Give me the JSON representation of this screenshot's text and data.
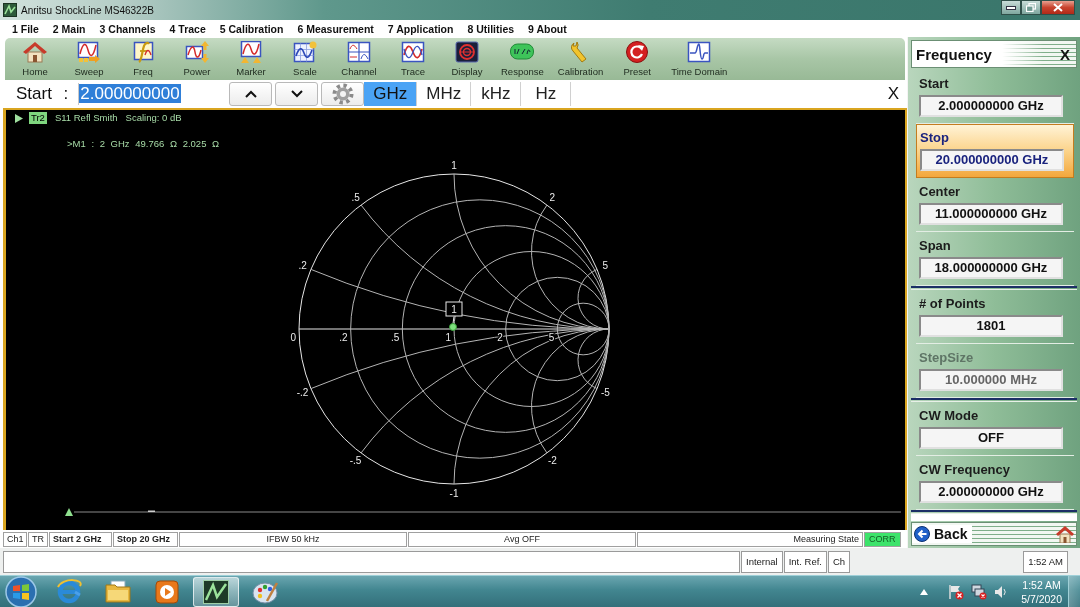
{
  "window": {
    "title": "Anritsu ShockLine MS46322B"
  },
  "menu": [
    "1 File",
    "2 Main",
    "3 Channels",
    "4 Trace",
    "5 Calibration",
    "6 Measurement",
    "7 Application",
    "8 Utilities",
    "9 About"
  ],
  "toolbar": [
    "Home",
    "Sweep",
    "Freq",
    "Power",
    "Marker",
    "Scale",
    "Channel",
    "Trace",
    "Display",
    "Response",
    "Calibration",
    "Preset",
    "Time Domain"
  ],
  "entry": {
    "label": "Start :",
    "value": "2.000000000",
    "value_selected": true,
    "units": [
      {
        "label": "GHz",
        "selected": true
      },
      {
        "label": "MHz",
        "selected": false
      },
      {
        "label": "kHz",
        "selected": false
      },
      {
        "label": "Hz",
        "selected": false
      }
    ],
    "close": "X"
  },
  "trace": {
    "badge": "Tr2",
    "title": "S11 Refl Smith",
    "scaling": "Scaling: 0 dB",
    "marker_readout": ">M1 : 2 GHz 49.766 Ω 2.025 Ω"
  },
  "smith_chart": {
    "resistance_labels": [
      "0",
      ".2",
      ".5",
      "1",
      "2",
      "5"
    ],
    "upper_reactance_labels": [
      ".2",
      ".5",
      "1",
      "2",
      "5"
    ],
    "lower_reactance_labels": [
      "-.2",
      "-.5",
      "-1",
      "-2",
      "-5"
    ],
    "marker_label": "1"
  },
  "side_panel": {
    "title": "Frequency",
    "close": "X",
    "groups": [
      {
        "items": [
          {
            "label": "Start",
            "value": "2.000000000 GHz",
            "selected": false,
            "disabled": false
          },
          {
            "label": "Stop",
            "value": "20.000000000 GHz",
            "selected": true,
            "disabled": false
          },
          {
            "label": "Center",
            "value": "11.000000000 GHz",
            "selected": false,
            "disabled": false
          },
          {
            "label": "Span",
            "value": "18.000000000 GHz",
            "selected": false,
            "disabled": false
          }
        ]
      },
      {
        "items": [
          {
            "label": "# of Points",
            "value": "1801",
            "selected": false,
            "disabled": false
          },
          {
            "label": "StepSize",
            "value": "10.000000 MHz",
            "selected": false,
            "disabled": true
          }
        ]
      },
      {
        "items": [
          {
            "label": "CW Mode",
            "value": "OFF",
            "selected": false,
            "disabled": false
          },
          {
            "label": "CW Frequency",
            "value": "2.000000000 GHz",
            "selected": false,
            "disabled": false
          }
        ]
      }
    ],
    "back": "Back"
  },
  "status_bar": {
    "cells": [
      {
        "text": "Ch1",
        "bold": false
      },
      {
        "text": "TR",
        "bold": false
      },
      {
        "text": "Start 2 GHz",
        "bold": true
      },
      {
        "text": "Stop 20 GHz",
        "bold": true
      },
      {
        "text": "IFBW 50 kHz",
        "bold": false
      },
      {
        "text": "Avg OFF",
        "bold": false
      },
      {
        "text": "Measuring State",
        "bold": false
      }
    ],
    "corr": {
      "label": "CORR",
      "on": true
    }
  },
  "message_bar": {
    "cells": [
      "Internal",
      "Int. Ref.",
      "Ch"
    ],
    "time": "1:52 AM"
  },
  "taskbar": {
    "time": "1:52 AM",
    "date": "5/7/2020"
  }
}
